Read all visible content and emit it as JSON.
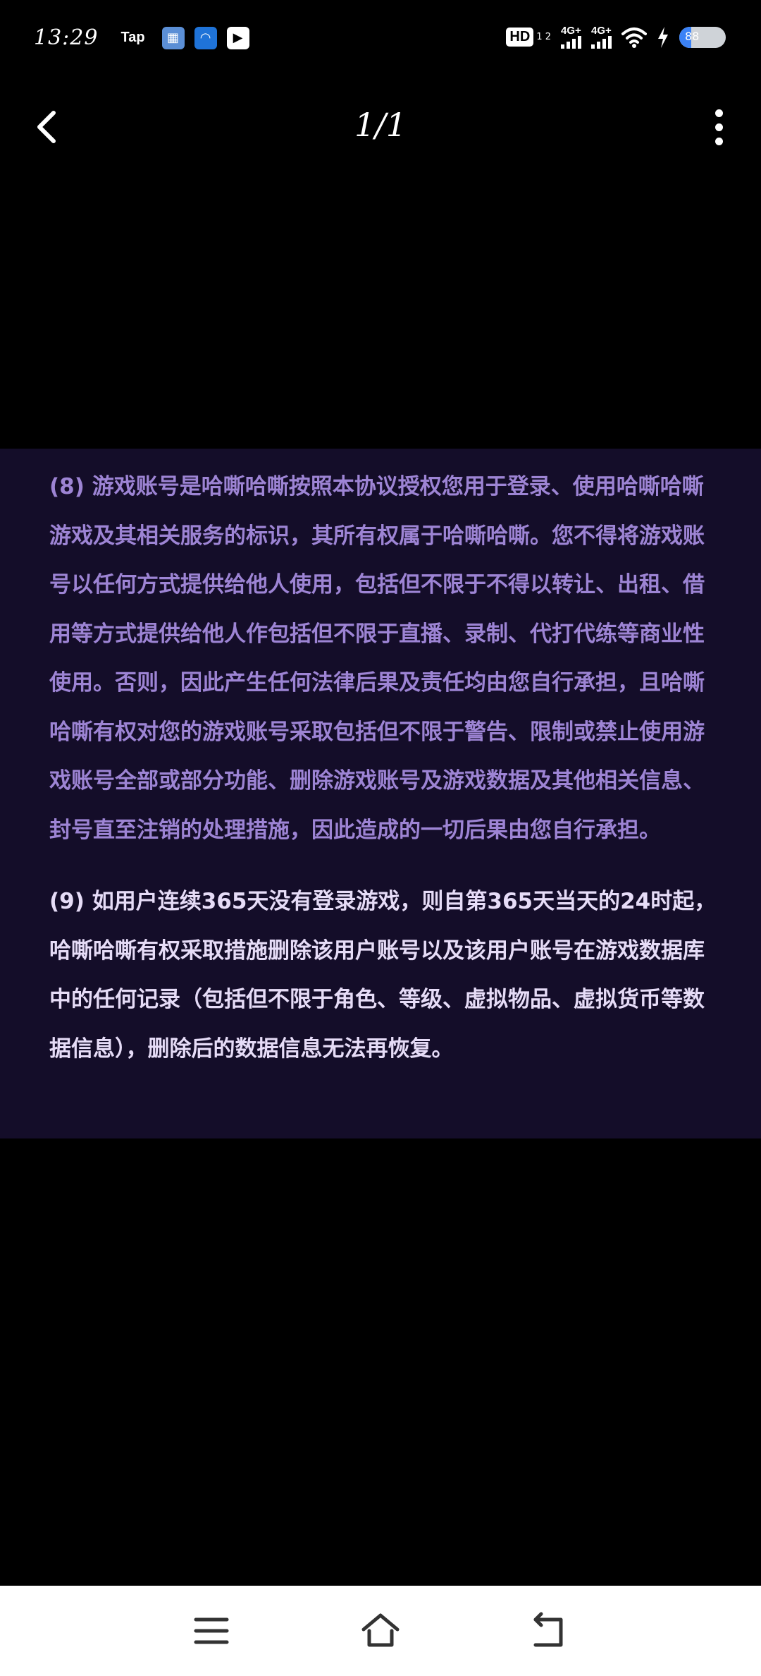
{
  "status_bar": {
    "time": "13:29",
    "app_label": "Tap",
    "hd_label": "HD",
    "hd_sub": "1 2",
    "network_1": "4G+",
    "network_2": "4G+",
    "battery_level": "88",
    "battery_fraction": 0.25
  },
  "nav": {
    "page_indicator": "1/1"
  },
  "content": {
    "clause_8": "(8) 游戏账号是哈嘶哈嘶按照本协议授权您用于登录、使用哈嘶哈嘶游戏及其相关服务的标识，其所有权属于哈嘶哈嘶。您不得将游戏账号以任何方式提供给他人使用，包括但不限于不得以转让、出租、借用等方式提供给他人作包括但不限于直播、录制、代打代练等商业性使用。否则，因此产生任何法律后果及责任均由您自行承担，且哈嘶哈嘶有权对您的游戏账号采取包括但不限于警告、限制或禁止使用游戏账号全部或部分功能、删除游戏账号及游戏数据及其他相关信息、封号直至注销的处理措施，因此造成的一切后果由您自行承担。",
    "clause_9": "(9) 如用户连续365天没有登录游戏，则自第365天当天的24时起，哈嘶哈嘶有权采取措施删除该用户账号以及该用户账号在游戏数据库中的任何记录（包括但不限于角色、等级、虚拟物品、虚拟货币等数据信息），删除后的数据信息无法再恢复。"
  },
  "colors": {
    "panel_bg": "#140d29",
    "clause_8_text": "#9d84d4",
    "clause_9_text": "#e6dcf7"
  }
}
